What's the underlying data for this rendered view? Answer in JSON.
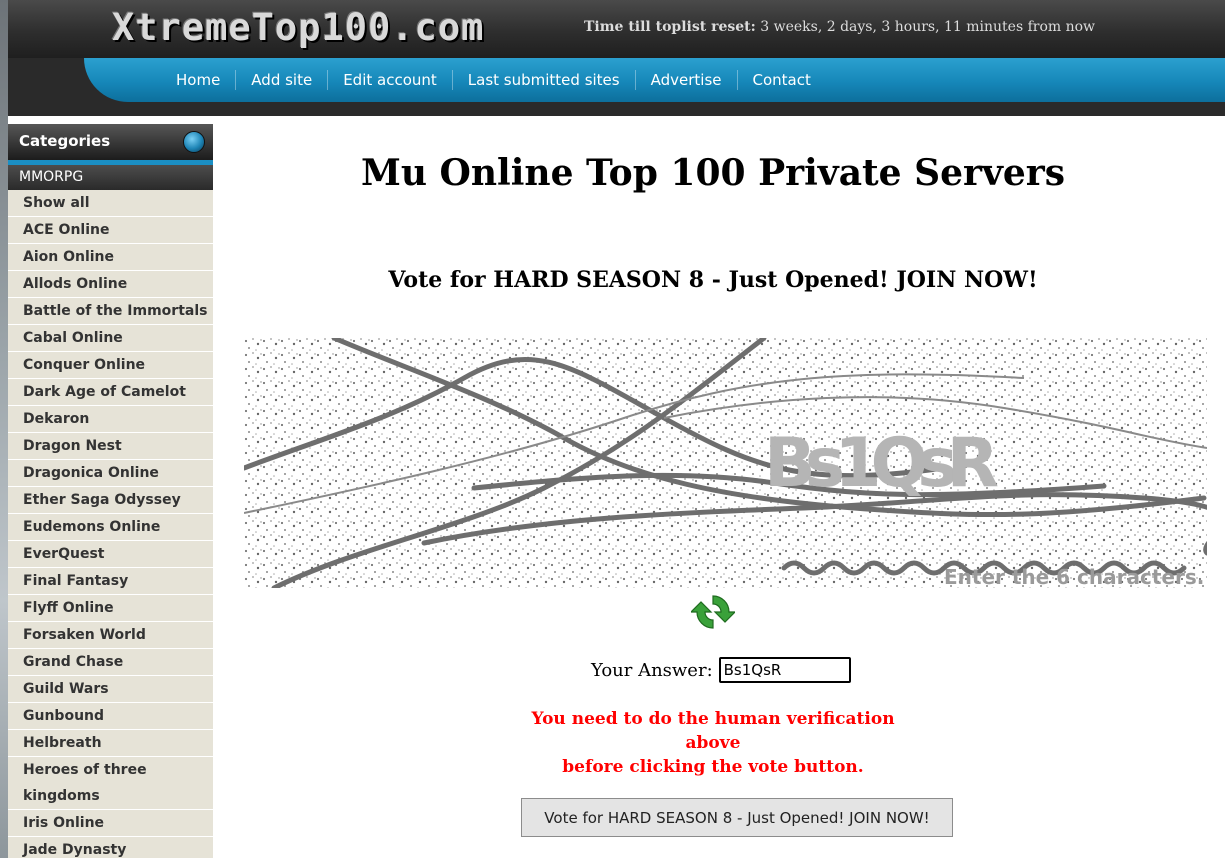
{
  "site": {
    "logo": "XtremeTop100.com",
    "reset_label": "Time till toplist reset:",
    "reset_value": "3 weeks, 2 days, 3 hours, 11 minutes from now"
  },
  "nav": [
    "Home",
    "Add site",
    "Edit account",
    "Last submitted sites",
    "Advertise",
    "Contact"
  ],
  "sidebar": {
    "header": "Categories",
    "group": "MMORPG",
    "items": [
      "Show all",
      "ACE Online",
      "Aion Online",
      "Allods Online",
      "Battle of the Immortals",
      "Cabal Online",
      "Conquer Online",
      "Dark Age of Camelot",
      "Dekaron",
      "Dragon Nest",
      "Dragonica Online",
      "Ether Saga Odyssey",
      "Eudemons Online",
      "EverQuest",
      "Final Fantasy",
      "Flyff Online",
      "Forsaken World",
      "Grand Chase",
      "Guild Wars",
      "Gunbound",
      "Helbreath",
      "Heroes of three kingdoms",
      "Iris Online",
      "Jade Dynasty"
    ]
  },
  "main": {
    "title": "Mu Online Top 100 Private Servers",
    "subtitle": "Vote for HARD SEASON 8 - Just Opened! JOIN NOW!",
    "captcha_code": "Bs1QsR",
    "captcha_hint": "Enter the 6 characters.",
    "answer_label": "Your Answer:",
    "answer_value": "Bs1QsR",
    "warning_line1": "You need to do the human verification above",
    "warning_line2": "before clicking the vote button.",
    "vote_button": "Vote for HARD SEASON 8 - Just Opened! JOIN NOW!"
  },
  "colors": {
    "accent": "#1b8fc4",
    "warning": "#ff0000",
    "sidebar_bg": "#e6e3d7"
  }
}
